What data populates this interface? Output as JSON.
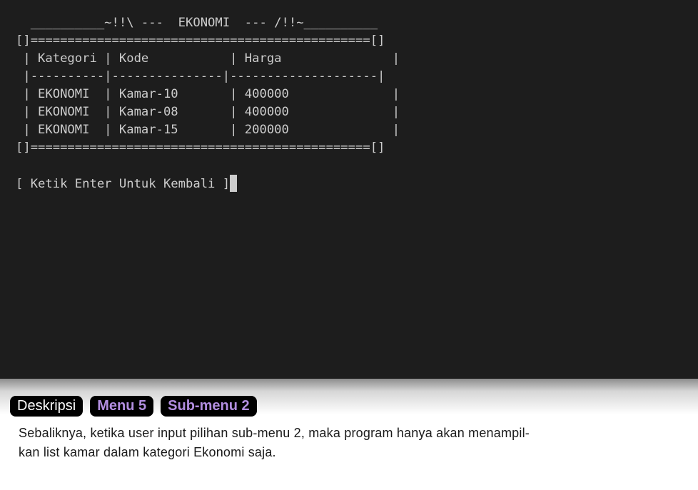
{
  "terminal": {
    "header_line": "  __________~!!\\ ---  EKONOMI  --- /!!~__________",
    "border_top": "[]==============================================[]",
    "table_header": " | Kategori | Kode           | Harga               |",
    "table_separator": " |----------|---------------|--------------------|",
    "rows": [
      " | EKONOMI  | Kamar-10       | 400000              |",
      " | EKONOMI  | Kamar-08       | 400000              |",
      " | EKONOMI  | Kamar-15       | 200000              |"
    ],
    "border_bottom": "[]==============================================[]",
    "prompt": "[ Ketik Enter Untuk Kembali ]"
  },
  "caption": {
    "tags": [
      "Deskripsi",
      "Menu 5",
      "Sub-menu 2"
    ],
    "description_line1": "Sebaliknya, ketika user input pilihan sub-menu 2, maka program hanya akan menampil-",
    "description_line2": "kan list kamar dalam kategori Ekonomi saja."
  },
  "colors": {
    "terminal_bg": "#1d1d1d",
    "terminal_text": "#cccccc",
    "tag_bg": "#000000",
    "tag_accent": "#b28ee0"
  }
}
